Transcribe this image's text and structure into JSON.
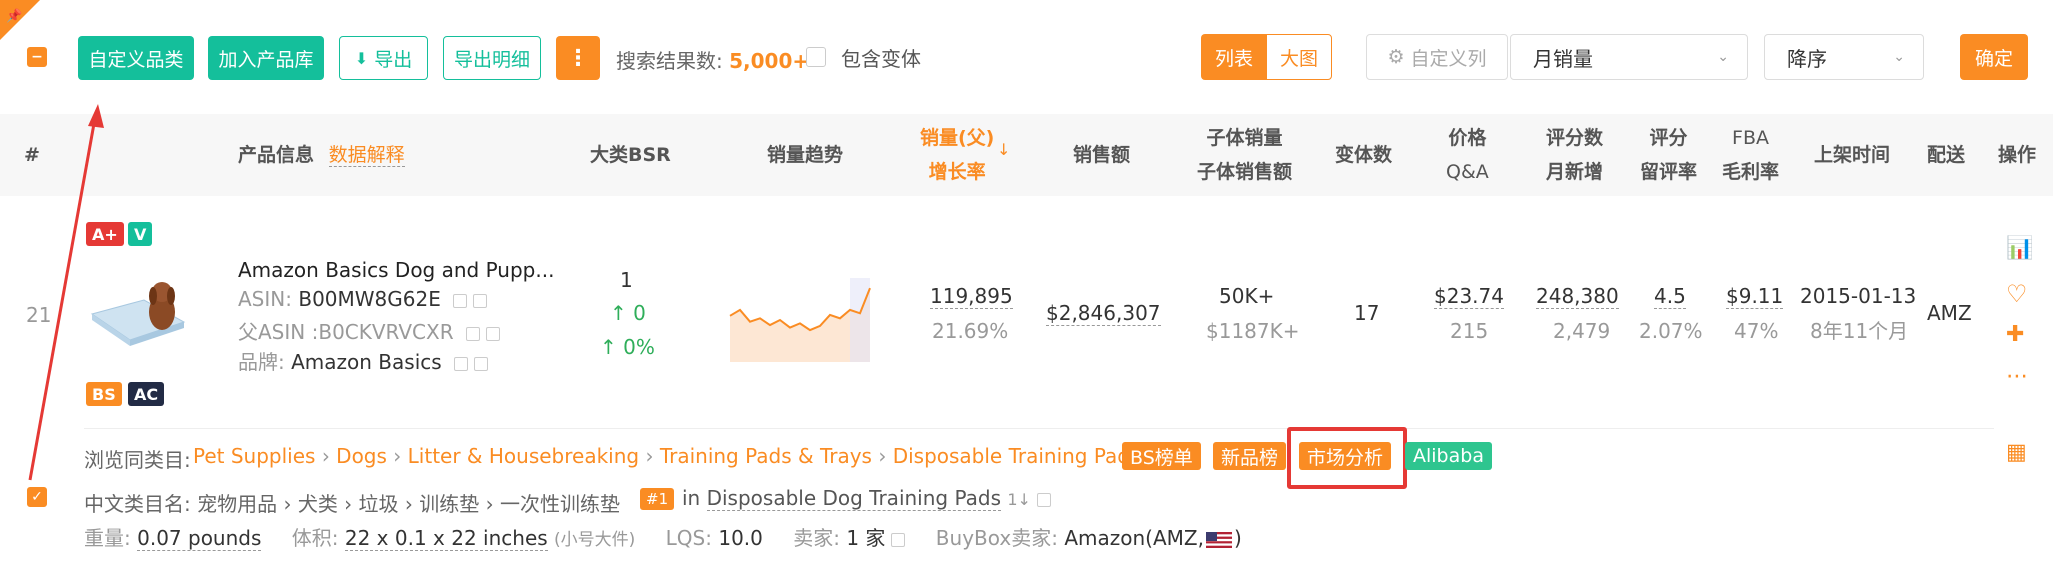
{
  "toolbar": {
    "custom_category": "自定义品类",
    "add_to_library": "加入产品库",
    "export": "导出",
    "export_detail": "导出明细",
    "result_label": "搜索结果数:",
    "result_count": "5,000+",
    "include_variants": "包含变体",
    "view_list": "列表",
    "view_grid": "大图",
    "custom_columns": "自定义列",
    "sort_field": "月销量",
    "sort_order": "降序",
    "confirm": "确定"
  },
  "table_header": {
    "index": "#",
    "product_info": "产品信息",
    "data_explain": "数据解释",
    "bsr": "大类BSR",
    "trend": "销量趋势",
    "sales_parent": "销量(父)",
    "growth": "增长率",
    "revenue": "销售额",
    "child_sales": "子体销量",
    "child_revenue": "子体销售额",
    "variants": "变体数",
    "price": "价格",
    "qa": "Q&A",
    "rating_count": "评分数",
    "monthly_new": "月新增",
    "rating": "评分",
    "retention": "留评率",
    "fba": "FBA",
    "margin": "毛利率",
    "launch": "上架时间",
    "delivery": "配送",
    "ops": "操作"
  },
  "row": {
    "index": "21",
    "badge_aplus": "A+",
    "badge_v": "V",
    "badge_bs": "BS",
    "badge_ac": "AC",
    "title": "Amazon Basics Dog and Pupp...",
    "asin_label": "ASIN:",
    "asin": "B00MW8G62E",
    "parent_asin_label": "父ASIN :",
    "parent_asin": "B0CKVRVCXR",
    "brand_label": "品牌:",
    "brand": "Amazon Basics",
    "bsr": "1",
    "bsr_change": "0",
    "bsr_pct": "0%",
    "sales": "119,895",
    "growth": "21.69%",
    "revenue": "$2,846,307",
    "child_sales": "50K+",
    "child_revenue": "$1187K+",
    "variants": "17",
    "price": "$23.74",
    "qa": "215",
    "rating_count": "248,380",
    "monthly_new": "2,479",
    "rating": "4.5",
    "retention": "2.07%",
    "fba": "$9.11",
    "margin": "47%",
    "launch_date": "2015-01-13",
    "launch_age": "8年11个月",
    "delivery": "AMZ",
    "trend_series": [
      0.55,
      0.62,
      0.48,
      0.52,
      0.44,
      0.5,
      0.41,
      0.46,
      0.38,
      0.43,
      0.56,
      0.52,
      0.62,
      0.58,
      0.88
    ]
  },
  "detail": {
    "browse_label": "浏览同类目:",
    "crumbs": [
      "Pet Supplies",
      "Dogs",
      "Litter & Housebreaking",
      "Training Pads & Trays",
      "Disposable Training Pads"
    ],
    "tag_bs": "BS榜单",
    "tag_new": "新品榜",
    "tag_market": "市场分析",
    "tag_alibaba": "Alibaba",
    "cn_category_label": "中文类目名:",
    "cn_category": "宠物用品 › 犬类 › 垃圾 › 训练垫 › 一次性训练垫",
    "rank_badge": "#1",
    "rank_in": "in",
    "rank_category": "Disposable Dog Training Pads",
    "weight_label": "重量:",
    "weight": "0.07 pounds",
    "volume_label": "体积:",
    "volume": "22 x 0.1 x 22 inches",
    "size_class": "(小号大件)",
    "lqs_label": "LQS:",
    "lqs": "10.0",
    "sellers_label": "卖家:",
    "sellers": "1 家",
    "buybox_label": "BuyBox卖家:",
    "buybox": "Amazon(AMZ,",
    "buybox_end": ")"
  },
  "colors": {
    "green": "#14bf9b",
    "orange": "#fa8c23",
    "red": "#e53935"
  }
}
